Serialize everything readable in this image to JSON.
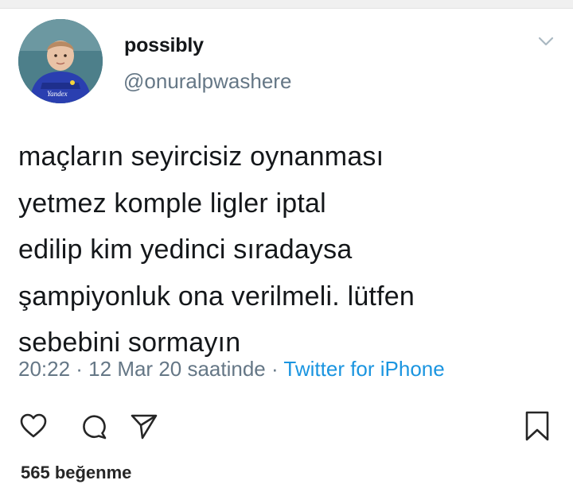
{
  "tweet": {
    "display_name": "possibly",
    "handle": "@onuralpwashere",
    "text_lines": [
      "maçların seyircisiz oynanması",
      "yetmez komple ligler iptal",
      "edilip kim yedinci sıradaysa",
      "şampiyonluk ona verilmeli. lütfen",
      "sebebini sormayın"
    ],
    "timestamp": "20:22 · 12 Mar 20 saatinde",
    "separator": " · ",
    "source": "Twitter for iPhone",
    "jersey_text": "Yandex"
  },
  "post": {
    "likes_text": "565 beğenme"
  },
  "icons": {
    "heart": "heart-icon",
    "comment": "comment-icon",
    "share": "share-icon",
    "bookmark": "bookmark-icon",
    "more": "chevron-down-icon"
  },
  "colors": {
    "text": "#14171a",
    "muted": "#657786",
    "link": "#1b95e0"
  }
}
